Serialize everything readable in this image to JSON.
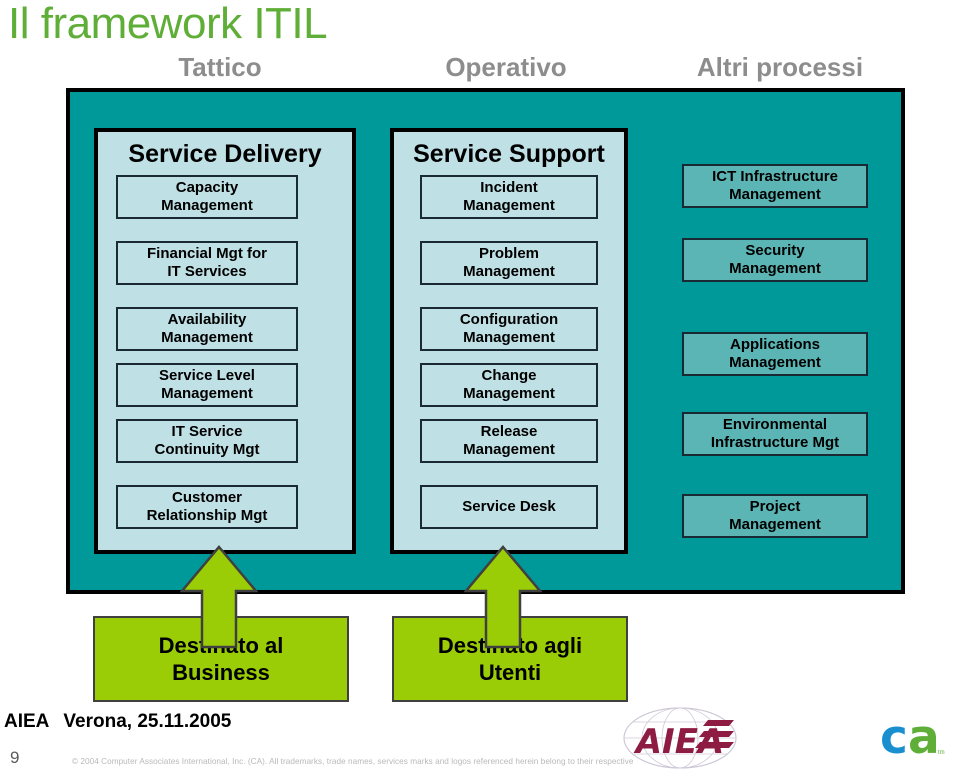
{
  "slide": {
    "title": "Il framework ITIL",
    "number": "9",
    "copyright": "© 2004 Computer Associates International, Inc. (CA). All trademarks, trade names, services marks and logos referenced herein belong to their respective",
    "footer_org": "AIEA",
    "footer_event": "Verona, 25.11.2005"
  },
  "colors": {
    "title_green": "#5FAE38",
    "caption_gray": "#8D8D8D",
    "panel_teal": "#009999",
    "subpanel_blue": "#BFE0E5",
    "box_teal": "#5CB5B5",
    "arrow_green": "#9ACD06"
  },
  "captions": {
    "tattico": "Tattico",
    "operativo": "Operativo",
    "altri": "Altri processi"
  },
  "service_delivery": {
    "title": "Service Delivery",
    "processes": [
      {
        "line1": "Capacity",
        "line2": "Management"
      },
      {
        "line1": "Financial Mgt for",
        "line2": "IT Services"
      },
      {
        "line1": "Availability",
        "line2": "Management"
      },
      {
        "line1": "Service Level",
        "line2": "Management"
      },
      {
        "line1": "IT Service",
        "line2": "Continuity Mgt"
      },
      {
        "line1": "Customer",
        "line2": "Relationship Mgt"
      }
    ]
  },
  "service_support": {
    "title": "Service Support",
    "processes": [
      {
        "line1": "Incident",
        "line2": "Management"
      },
      {
        "line1": "Problem",
        "line2": "Management"
      },
      {
        "line1": "Configuration",
        "line2": "Management"
      },
      {
        "line1": "Change",
        "line2": "Management"
      },
      {
        "line1": "Release",
        "line2": "Management"
      },
      {
        "line1": "Service Desk",
        "line2": ""
      }
    ]
  },
  "altri_processi": {
    "processes": [
      {
        "line1": "ICT Infrastructure",
        "line2": "Management"
      },
      {
        "line1": "Security",
        "line2": "Management"
      },
      {
        "line1": "Applications",
        "line2": "Management"
      },
      {
        "line1": "Environmental",
        "line2": "Infrastructure Mgt"
      },
      {
        "line1": "Project",
        "line2": "Management"
      }
    ]
  },
  "destinations": [
    {
      "line1": "Destinato al",
      "line2": "Business"
    },
    {
      "line1": "Destinato agli",
      "line2": "Utenti"
    }
  ],
  "logos": {
    "aiea": "AIEA",
    "ca_c": "c",
    "ca_a": "a",
    "ca_tm": "tm"
  }
}
